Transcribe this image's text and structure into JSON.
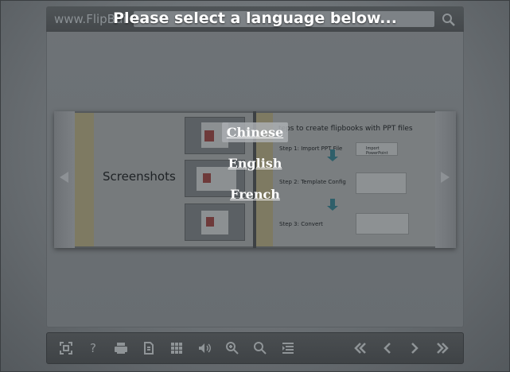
{
  "header": {
    "brand": "www.FlipBuilder",
    "icons": [
      "search-icon"
    ]
  },
  "overlay": {
    "title": "Please select a language below...",
    "languages": [
      {
        "label": "Chinese",
        "selected": true
      },
      {
        "label": "English",
        "selected": false
      },
      {
        "label": "French",
        "selected": false
      }
    ]
  },
  "book": {
    "left_page": {
      "title": "Screenshots"
    },
    "right_page": {
      "title": "teps to create flipbooks with PPT files",
      "steps": [
        "Step 1: Import PPT File",
        "Step 2: Template Config",
        "Step 3: Convert"
      ],
      "button_label": "Import PowerPoint"
    }
  },
  "toolbar": {
    "icons": [
      "fullscreen-icon",
      "help-icon",
      "print-icon",
      "document-icon",
      "thumbnails-icon",
      "sound-icon",
      "zoom-in-icon",
      "search-icon",
      "table-of-contents-icon",
      "first-page-icon",
      "previous-page-icon",
      "next-page-icon",
      "last-page-icon"
    ]
  },
  "colors": {
    "background": "#6b7074",
    "toolbar": "#44484b",
    "overlay_text": "#ffffff",
    "icon": "#8f9497"
  }
}
